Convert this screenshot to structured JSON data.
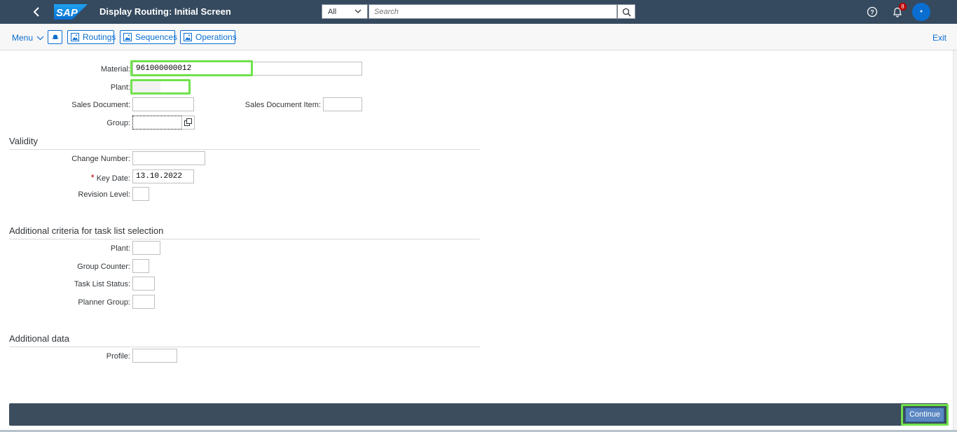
{
  "shell": {
    "title": "Display Routing: Initial Screen",
    "search_scope": "All",
    "search_placeholder": "Search",
    "notification_count": "8"
  },
  "toolbar": {
    "menu_label": "Menu",
    "buttons": [
      "Routings",
      "Sequences",
      "Operations"
    ],
    "exit_label": "Exit"
  },
  "form": {
    "material_label": "Material:",
    "material_value": "961000000012",
    "plant_label": "Plant:",
    "plant_value": "",
    "sales_document_label": "Sales Document:",
    "sales_document_item_label": "Sales Document Item:",
    "group_label": "Group:"
  },
  "validity": {
    "heading": "Validity",
    "change_number_label": "Change Number:",
    "key_date_label": "Key Date:",
    "key_date_value": "13.10.2022",
    "revision_level_label": "Revision Level:"
  },
  "criteria": {
    "heading": "Additional criteria for task list selection",
    "plant_label": "Plant:",
    "group_counter_label": "Group Counter:",
    "task_list_status_label": "Task List Status:",
    "planner_group_label": "Planner Group:"
  },
  "additional": {
    "heading": "Additional data",
    "profile_label": "Profile:"
  },
  "footer": {
    "continue_label": "Continue"
  },
  "colors": {
    "shell_bg": "#354a5f",
    "highlight": "#6fe24c",
    "footer_bg": "#3c4d5d",
    "accent": "#0a6ed1"
  }
}
